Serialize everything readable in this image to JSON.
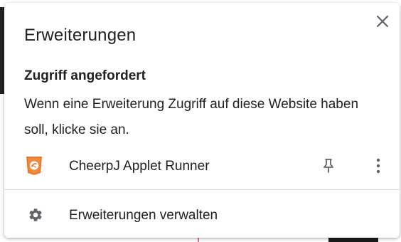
{
  "popup": {
    "title": "Erweiterungen",
    "close_icon": "close-icon",
    "section_heading": "Zugriff angefordert",
    "description": "Wenn eine Erweiterung Zugriff auf diese Website haben soll, klicke sie an.",
    "extensions": [
      {
        "name": "CheerpJ Applet Runner",
        "icon": "cheerpj-shield-icon",
        "icon_color": "#e8772e",
        "pin_icon": "pin-icon",
        "menu_icon": "more-vert-icon"
      }
    ],
    "manage": {
      "label": "Erweiterungen verwalten",
      "icon": "gear-icon"
    }
  },
  "colors": {
    "text": "#202124",
    "icon": "#5f6368",
    "divider": "#dadce0",
    "accent_orange": "#e8772e"
  }
}
